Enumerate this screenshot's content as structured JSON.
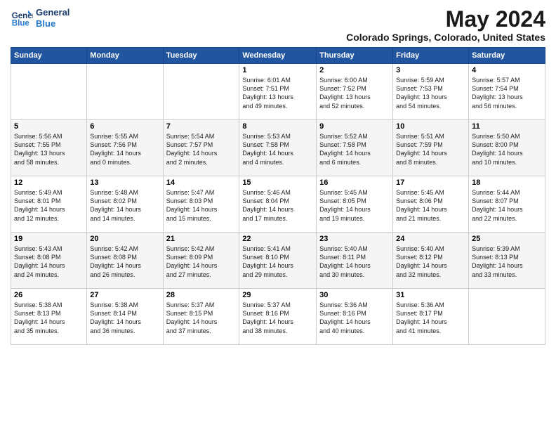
{
  "header": {
    "logo_line1": "General",
    "logo_line2": "Blue",
    "month": "May 2024",
    "location": "Colorado Springs, Colorado, United States"
  },
  "weekdays": [
    "Sunday",
    "Monday",
    "Tuesday",
    "Wednesday",
    "Thursday",
    "Friday",
    "Saturday"
  ],
  "weeks": [
    [
      {
        "day": "",
        "text": ""
      },
      {
        "day": "",
        "text": ""
      },
      {
        "day": "",
        "text": ""
      },
      {
        "day": "1",
        "text": "Sunrise: 6:01 AM\nSunset: 7:51 PM\nDaylight: 13 hours\nand 49 minutes."
      },
      {
        "day": "2",
        "text": "Sunrise: 6:00 AM\nSunset: 7:52 PM\nDaylight: 13 hours\nand 52 minutes."
      },
      {
        "day": "3",
        "text": "Sunrise: 5:59 AM\nSunset: 7:53 PM\nDaylight: 13 hours\nand 54 minutes."
      },
      {
        "day": "4",
        "text": "Sunrise: 5:57 AM\nSunset: 7:54 PM\nDaylight: 13 hours\nand 56 minutes."
      }
    ],
    [
      {
        "day": "5",
        "text": "Sunrise: 5:56 AM\nSunset: 7:55 PM\nDaylight: 13 hours\nand 58 minutes."
      },
      {
        "day": "6",
        "text": "Sunrise: 5:55 AM\nSunset: 7:56 PM\nDaylight: 14 hours\nand 0 minutes."
      },
      {
        "day": "7",
        "text": "Sunrise: 5:54 AM\nSunset: 7:57 PM\nDaylight: 14 hours\nand 2 minutes."
      },
      {
        "day": "8",
        "text": "Sunrise: 5:53 AM\nSunset: 7:58 PM\nDaylight: 14 hours\nand 4 minutes."
      },
      {
        "day": "9",
        "text": "Sunrise: 5:52 AM\nSunset: 7:58 PM\nDaylight: 14 hours\nand 6 minutes."
      },
      {
        "day": "10",
        "text": "Sunrise: 5:51 AM\nSunset: 7:59 PM\nDaylight: 14 hours\nand 8 minutes."
      },
      {
        "day": "11",
        "text": "Sunrise: 5:50 AM\nSunset: 8:00 PM\nDaylight: 14 hours\nand 10 minutes."
      }
    ],
    [
      {
        "day": "12",
        "text": "Sunrise: 5:49 AM\nSunset: 8:01 PM\nDaylight: 14 hours\nand 12 minutes."
      },
      {
        "day": "13",
        "text": "Sunrise: 5:48 AM\nSunset: 8:02 PM\nDaylight: 14 hours\nand 14 minutes."
      },
      {
        "day": "14",
        "text": "Sunrise: 5:47 AM\nSunset: 8:03 PM\nDaylight: 14 hours\nand 15 minutes."
      },
      {
        "day": "15",
        "text": "Sunrise: 5:46 AM\nSunset: 8:04 PM\nDaylight: 14 hours\nand 17 minutes."
      },
      {
        "day": "16",
        "text": "Sunrise: 5:45 AM\nSunset: 8:05 PM\nDaylight: 14 hours\nand 19 minutes."
      },
      {
        "day": "17",
        "text": "Sunrise: 5:45 AM\nSunset: 8:06 PM\nDaylight: 14 hours\nand 21 minutes."
      },
      {
        "day": "18",
        "text": "Sunrise: 5:44 AM\nSunset: 8:07 PM\nDaylight: 14 hours\nand 22 minutes."
      }
    ],
    [
      {
        "day": "19",
        "text": "Sunrise: 5:43 AM\nSunset: 8:08 PM\nDaylight: 14 hours\nand 24 minutes."
      },
      {
        "day": "20",
        "text": "Sunrise: 5:42 AM\nSunset: 8:08 PM\nDaylight: 14 hours\nand 26 minutes."
      },
      {
        "day": "21",
        "text": "Sunrise: 5:42 AM\nSunset: 8:09 PM\nDaylight: 14 hours\nand 27 minutes."
      },
      {
        "day": "22",
        "text": "Sunrise: 5:41 AM\nSunset: 8:10 PM\nDaylight: 14 hours\nand 29 minutes."
      },
      {
        "day": "23",
        "text": "Sunrise: 5:40 AM\nSunset: 8:11 PM\nDaylight: 14 hours\nand 30 minutes."
      },
      {
        "day": "24",
        "text": "Sunrise: 5:40 AM\nSunset: 8:12 PM\nDaylight: 14 hours\nand 32 minutes."
      },
      {
        "day": "25",
        "text": "Sunrise: 5:39 AM\nSunset: 8:13 PM\nDaylight: 14 hours\nand 33 minutes."
      }
    ],
    [
      {
        "day": "26",
        "text": "Sunrise: 5:38 AM\nSunset: 8:13 PM\nDaylight: 14 hours\nand 35 minutes."
      },
      {
        "day": "27",
        "text": "Sunrise: 5:38 AM\nSunset: 8:14 PM\nDaylight: 14 hours\nand 36 minutes."
      },
      {
        "day": "28",
        "text": "Sunrise: 5:37 AM\nSunset: 8:15 PM\nDaylight: 14 hours\nand 37 minutes."
      },
      {
        "day": "29",
        "text": "Sunrise: 5:37 AM\nSunset: 8:16 PM\nDaylight: 14 hours\nand 38 minutes."
      },
      {
        "day": "30",
        "text": "Sunrise: 5:36 AM\nSunset: 8:16 PM\nDaylight: 14 hours\nand 40 minutes."
      },
      {
        "day": "31",
        "text": "Sunrise: 5:36 AM\nSunset: 8:17 PM\nDaylight: 14 hours\nand 41 minutes."
      },
      {
        "day": "",
        "text": ""
      }
    ]
  ]
}
